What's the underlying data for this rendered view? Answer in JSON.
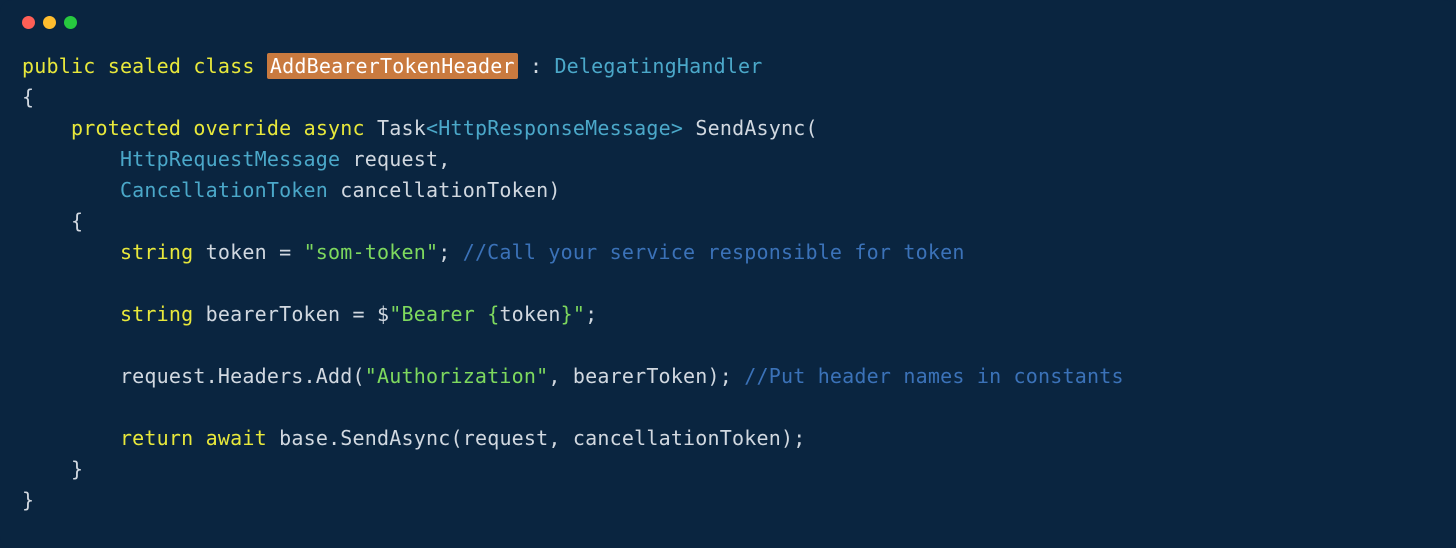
{
  "titlebar": {
    "buttons": [
      "close",
      "minimize",
      "maximize"
    ]
  },
  "code": {
    "line1": {
      "kw_public": "public",
      "kw_sealed": "sealed",
      "kw_class": "class",
      "classname": "AddBearerTokenHeader",
      "colon": " : ",
      "base": "DelegatingHandler"
    },
    "line2": "{",
    "line3": {
      "indent": "    ",
      "kw_protected": "protected",
      "kw_override": "override",
      "kw_async": "async",
      "task": "Task",
      "lt": "<",
      "resptype": "HttpResponseMessage",
      "gt": ">",
      "method": " SendAsync(",
      "close": ""
    },
    "line4": {
      "indent": "        ",
      "type": "HttpRequestMessage",
      "param": " request,"
    },
    "line5": {
      "indent": "        ",
      "type": "CancellationToken",
      "param": " cancellationToken)"
    },
    "line6": "    {",
    "line7": {
      "indent": "        ",
      "kw_string": "string",
      "var": " token = ",
      "str": "\"som-token\"",
      "semi": "; ",
      "comment": "//Call your service responsible for token"
    },
    "line8": "",
    "line9": {
      "indent": "        ",
      "kw_string": "string",
      "var": " bearerToken = $",
      "str_open": "\"Bearer ",
      "interp_open": "{",
      "interp_var": "token",
      "interp_close": "}",
      "str_close": "\"",
      "semi": ";"
    },
    "line10": "",
    "line11": {
      "indent": "        ",
      "call": "request.Headers.Add(",
      "str": "\"Authorization\"",
      "comma": ", bearerToken); ",
      "comment": "//Put header names in constants"
    },
    "line12": "",
    "line13": {
      "indent": "        ",
      "kw_return": "return",
      "sp": " ",
      "kw_await": "await",
      "call": " base.SendAsync(request, cancellationToken);"
    },
    "line14": "    }",
    "line15": "}"
  }
}
